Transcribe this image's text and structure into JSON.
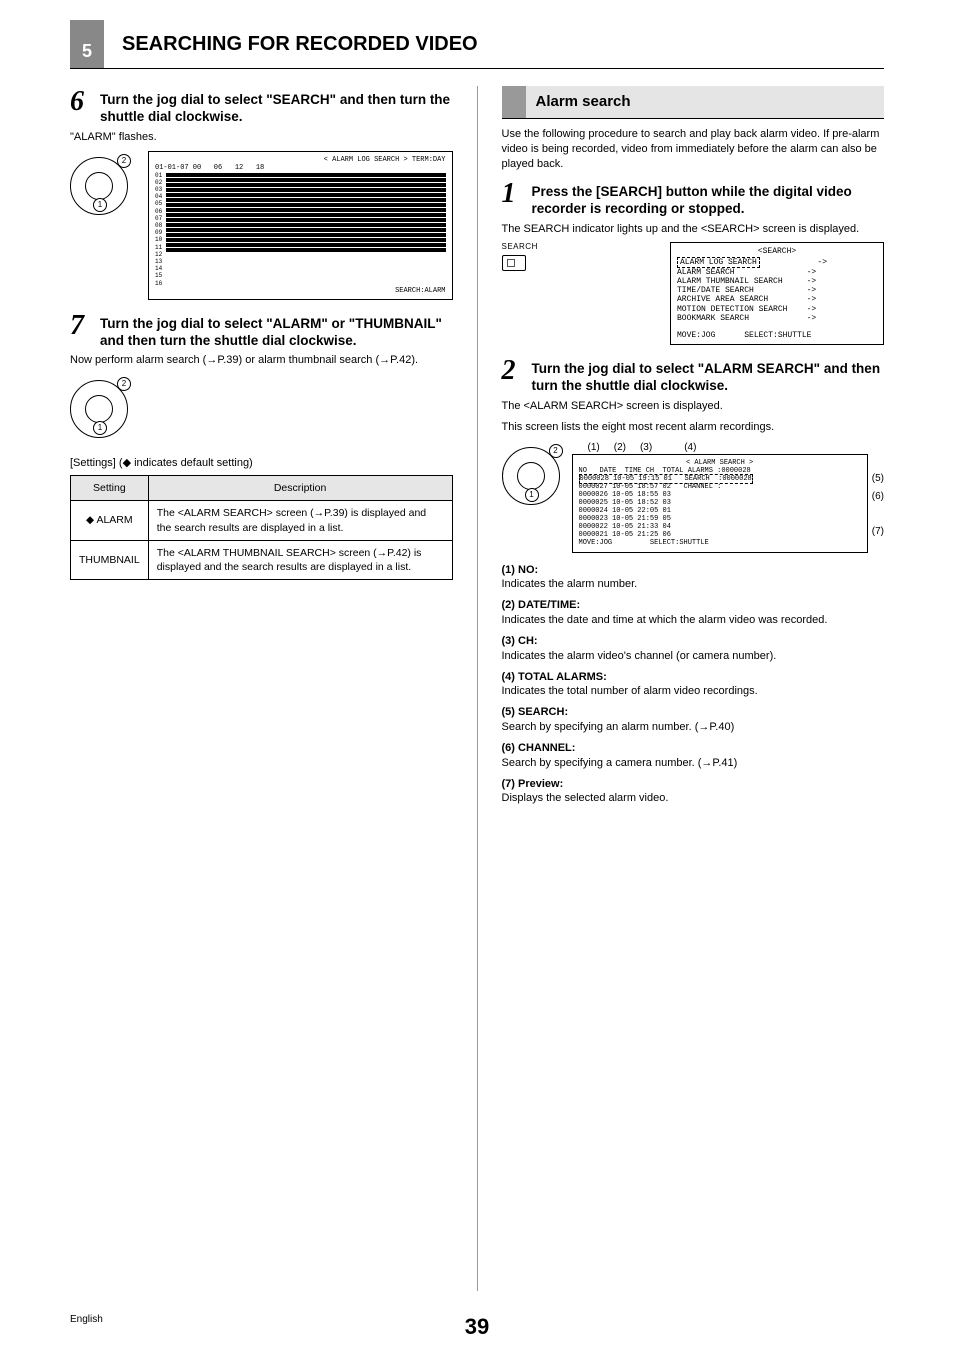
{
  "header": {
    "chapter_num": "5",
    "chapter_title": "SEARCHING FOR RECORDED VIDEO"
  },
  "left": {
    "step6": {
      "num": "6",
      "title": "Turn the jog dial to select \"SEARCH\" and then turn the shuttle dial clockwise.",
      "after": "\"ALARM\" flashes."
    },
    "osd1": {
      "title": "< ALARM LOG SEARCH > TERM:DAY",
      "heading": "01-01-07 00   06   12   18",
      "rows": [
        "01",
        "02",
        "03",
        "04",
        "05",
        "06",
        "07",
        "08",
        "09",
        "10",
        "11",
        "12",
        "13",
        "14",
        "15",
        "16"
      ],
      "footer": "SEARCH:ALARM"
    },
    "step7": {
      "num": "7",
      "title": "Turn the jog dial to select \"ALARM\" or \"THUMBNAIL\" and then turn the shuttle dial clockwise.",
      "after": "Now perform alarm search (→P.39) or alarm thumbnail search (→P.42)."
    },
    "settings_caption": "[Settings] (◆ indicates default setting)",
    "table": {
      "head": [
        "Setting",
        "Description"
      ],
      "rows": [
        {
          "setting": "◆ ALARM",
          "desc": "The <ALARM SEARCH> screen (→P.39) is displayed and the search results are displayed in a list."
        },
        {
          "setting": "THUMBNAIL",
          "desc": "The <ALARM THUMBNAIL SEARCH> screen (→P.42) is displayed and the search results are displayed in a list."
        }
      ]
    }
  },
  "right": {
    "section_title": "Alarm search",
    "intro": "Use the following procedure to search and play back alarm video. If pre-alarm video is being recorded, video from immediately before the alarm can also be played back.",
    "step1": {
      "num": "1",
      "title": "Press the [SEARCH] button while the digital video recorder is recording or stopped.",
      "after": "The SEARCH indicator lights up and the <SEARCH> screen is displayed."
    },
    "search_ind_label": "SEARCH",
    "osd_search": {
      "title": "<SEARCH>",
      "items": [
        "ALARM LOG SEARCH",
        "ALARM SEARCH",
        "ALARM THUMBNAIL SEARCH",
        "TIME/DATE SEARCH",
        "ARCHIVE AREA SEARCH",
        "MOTION DETECTION SEARCH",
        "BOOKMARK SEARCH"
      ],
      "footer": "MOVE:JOG      SELECT:SHUTTLE"
    },
    "step2": {
      "num": "2",
      "title": "Turn the jog dial to select \"ALARM SEARCH\" and then turn the shuttle dial clockwise.",
      "after1": "The <ALARM SEARCH> screen is displayed.",
      "after2": "This screen lists the eight most recent alarm recordings."
    },
    "osd_alarm": {
      "title": "< ALARM SEARCH >",
      "col_heads": "NO   DATE  TIME CH  TOTAL ALARMS :0000028",
      "rows": [
        "0000028 10-05 19:15 01   SEARCH  :0000028",
        "0000027 10-05 18:57 02   CHANNEL :",
        "0000026 10-05 18:55 03",
        "0000025 10-05 18:52 03",
        "0000024 10-05 22:05 01",
        "0000023 10-05 21:59 05",
        "0000022 10-05 21:33 04",
        "0000021 10-05 21:25 06"
      ],
      "footer": "MOVE:JOG         SELECT:SHUTTLE"
    },
    "callouts_top": [
      "(1)",
      "(2)",
      "(3)",
      "(4)"
    ],
    "callouts_side": [
      "(5)",
      "(6)",
      "(7)"
    ],
    "defs": [
      {
        "t": "(1)  NO:",
        "d": "Indicates the alarm number."
      },
      {
        "t": "(2)  DATE/TIME:",
        "d": "Indicates the date and time at which the alarm video was recorded."
      },
      {
        "t": "(3)  CH:",
        "d": "Indicates the alarm video's channel (or camera number)."
      },
      {
        "t": "(4)  TOTAL ALARMS:",
        "d": "Indicates the total number of alarm video recordings."
      },
      {
        "t": "(5)  SEARCH:",
        "d": "Search by specifying an alarm number. (→P.40)"
      },
      {
        "t": "(6)  CHANNEL:",
        "d": "Search by specifying a camera number. (→P.41)"
      },
      {
        "t": "(7)  Preview:",
        "d": "Displays the selected alarm video."
      }
    ]
  },
  "footer": {
    "lang": "English",
    "page": "39"
  }
}
